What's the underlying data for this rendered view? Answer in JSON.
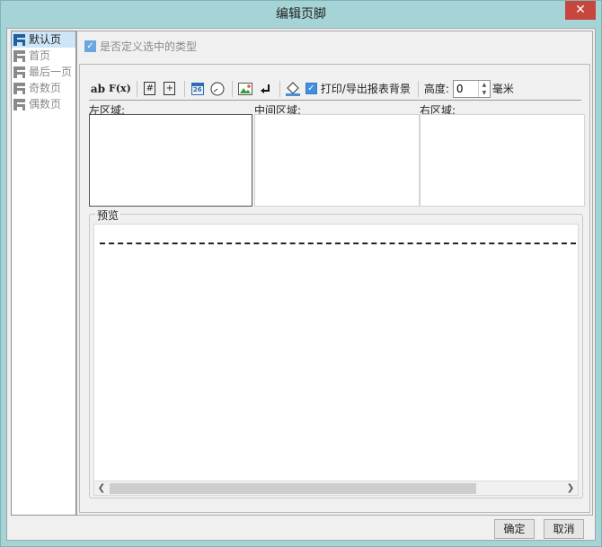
{
  "window": {
    "title": "编辑页脚",
    "close_glyph": "✕"
  },
  "page_list": {
    "items": [
      {
        "label": "默认页",
        "selected": true
      },
      {
        "label": "首页"
      },
      {
        "label": "最后一页"
      },
      {
        "label": "奇数页"
      },
      {
        "label": "偶数页"
      }
    ]
  },
  "custom_type": {
    "label": "是否定义选中的类型",
    "checked": true
  },
  "toolbar": {
    "text_icon": "ab",
    "formula_icon": "F(x)",
    "page_number_icon": "#",
    "total_pages_icon": "+",
    "date_icon": "26",
    "print_bg_label": "打印/导出报表背景",
    "print_bg_checked": true,
    "height_label": "高度:",
    "height_value": "0",
    "height_unit": "毫米"
  },
  "regions": {
    "left": "左区域:",
    "middle": "中间区域:",
    "right": "右区域:"
  },
  "preview": {
    "label": "预览"
  },
  "buttons": {
    "ok": "确定",
    "cancel": "取消"
  },
  "colors": {
    "accent": "#3f8ee0",
    "close": "#c7463d",
    "frame": "#a6d4d6"
  }
}
